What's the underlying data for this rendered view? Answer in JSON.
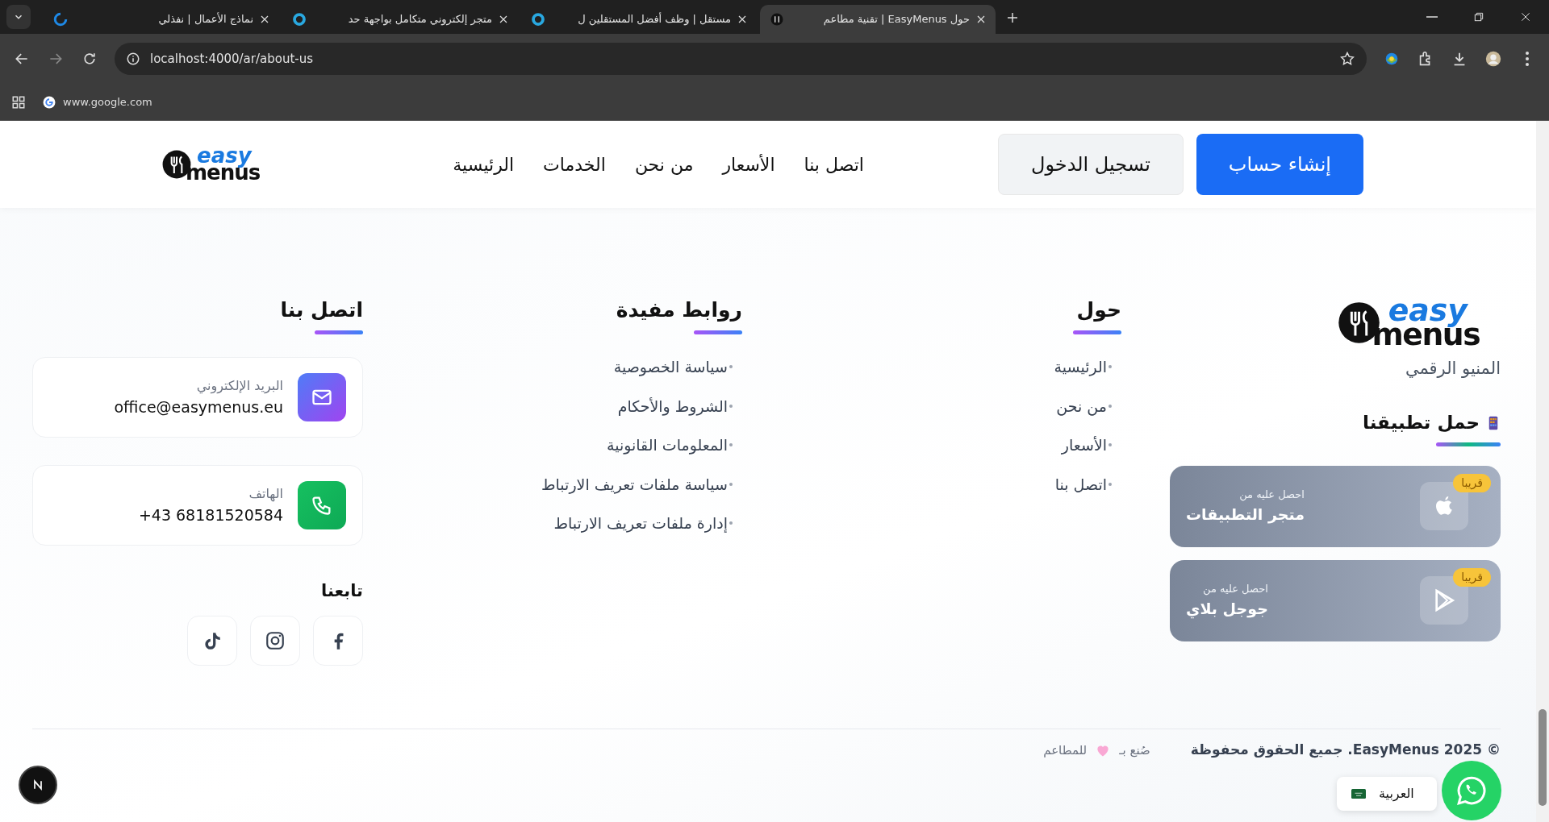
{
  "browser": {
    "tabs": [
      {
        "title": "حول EasyMenus | تقنية مطاعم",
        "kind": "logo",
        "selected": true
      },
      {
        "title": "مستقل | وظف أفضل المستقلين ل",
        "kind": "ring",
        "selected": false
      },
      {
        "title": "متجر إلكتروني متكامل بواجهة حد",
        "kind": "ring",
        "selected": false
      },
      {
        "title": "نماذج الأعمال | نفذلي",
        "kind": "swirl",
        "selected": false
      }
    ],
    "address": "localhost:4000/ar/about-us",
    "bookmarks": [
      "www.google.com"
    ]
  },
  "header": {
    "logo": {
      "line1": "easy",
      "line2": "menus"
    },
    "buttons": [
      {
        "label": "إنشاء حساب",
        "kind": "primary"
      },
      {
        "label": "تسجيل الدخول",
        "kind": "secondary"
      }
    ],
    "nav": [
      "اتصل بنا",
      "الأسعار",
      "من نحن",
      "الخدمات",
      "الرئيسية"
    ]
  },
  "footer": {
    "brand": {
      "logo": {
        "line1": "easy",
        "line2": "menus"
      },
      "tagline": "المنيو الرقمي",
      "app_heading": "حمل تطبيقنا",
      "stores": [
        {
          "kind": "apple",
          "caption": "احصل عليه من",
          "name": "متجر التطبيقات",
          "badge": "قريبا"
        },
        {
          "kind": "play",
          "caption": "احصل عليه من",
          "name": "جوجل بلاي",
          "badge": "قريبا"
        }
      ]
    },
    "about": {
      "heading": "حول",
      "links": [
        "الرئيسية",
        "من نحن",
        "الأسعار",
        "اتصل بنا"
      ]
    },
    "useful": {
      "heading": "روابط مفيدة",
      "links": [
        "سياسة الخصوصية",
        "الشروط والأحكام",
        "المعلومات القانونية",
        "سياسة ملفات تعريف الارتباط",
        "إدارة ملفات تعريف الارتباط"
      ]
    },
    "contact": {
      "heading": "اتصل بنا",
      "items": [
        {
          "kind": "email",
          "label": "البريد الإلكتروني",
          "value": "office@easymenus.eu"
        },
        {
          "kind": "phone",
          "label": "الهاتف",
          "value": "+43 68181520584"
        }
      ],
      "follow_heading": "تابعنا",
      "socials": [
        {
          "kind": "facebook"
        },
        {
          "kind": "instagram"
        },
        {
          "kind": "tiktok"
        }
      ]
    },
    "copyright": "© 2025 EasyMenus. جميع الحقوق محفوظة",
    "made_by": {
      "prefix": "صُنع بـ",
      "suffix": "للمطاعم"
    },
    "language": "العربية"
  }
}
